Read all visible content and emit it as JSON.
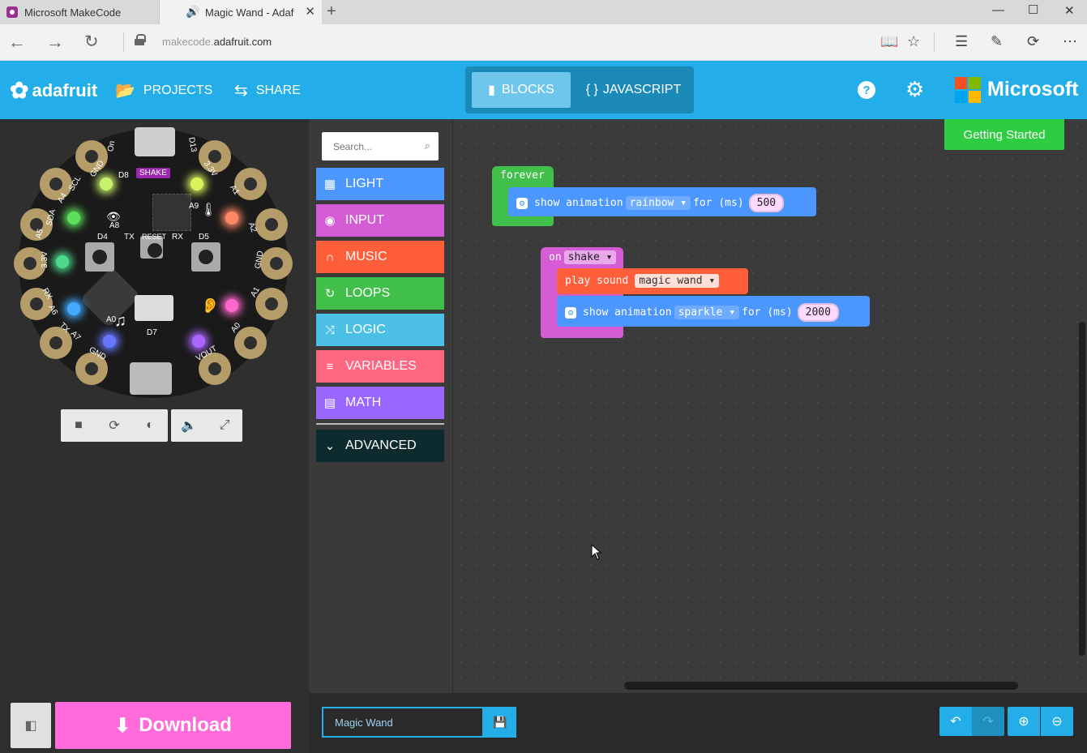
{
  "browser": {
    "tabs": [
      {
        "title": "Microsoft MakeCode"
      },
      {
        "title": "Magic Wand - Adaf"
      }
    ],
    "address": {
      "prefix": "makecode.",
      "domain": "adafruit.com"
    }
  },
  "header": {
    "brand": "adafruit",
    "projects_label": "PROJECTS",
    "share_label": "SHARE",
    "blocks_label": "BLOCKS",
    "javascript_label": "JAVASCRIPT",
    "microsoft_label": "Microsoft"
  },
  "simulator": {
    "shake_label": "SHAKE",
    "pin_labels": [
      "On",
      "D13",
      "GND",
      "3.3V",
      "D8",
      "A1",
      "A9",
      "SCL",
      "A4",
      "A2",
      "SDA",
      "A5",
      "A8",
      "D4",
      "TX",
      "RESET",
      "RX",
      "D5",
      "3.3V",
      "GND",
      "RX",
      "A6",
      "A1",
      "TX",
      "A7",
      "A0",
      "D7",
      "GND",
      "VOUT",
      "A0"
    ],
    "led_colors": [
      "#c8f26b",
      "#d9f35a",
      "#5be05b",
      "#ff8866",
      "#4cd98a",
      "#ffffff",
      "#44aaff",
      "#ff66cc",
      "#6677ff",
      "#aa66ff"
    ]
  },
  "toolbox": {
    "search_placeholder": "Search...",
    "categories": [
      {
        "label": "LIGHT",
        "color": "#4c97ff",
        "icon": "grid-icon"
      },
      {
        "label": "INPUT",
        "color": "#d65cd6",
        "icon": "target-icon"
      },
      {
        "label": "MUSIC",
        "color": "#ff5e3a",
        "icon": "headphones-icon"
      },
      {
        "label": "LOOPS",
        "color": "#40bf4a",
        "icon": "refresh-icon"
      },
      {
        "label": "LOGIC",
        "color": "#4cbfe6",
        "icon": "shuffle-icon"
      },
      {
        "label": "VARIABLES",
        "color": "#ff6680",
        "icon": "lines-icon"
      },
      {
        "label": "MATH",
        "color": "#9966ff",
        "icon": "calculator-icon"
      }
    ],
    "advanced_label": "ADVANCED"
  },
  "workspace": {
    "getting_started": "Getting Started",
    "forever_block": {
      "hat": "forever",
      "show_label": "show animation",
      "animation": "rainbow",
      "for_label": "for (ms)",
      "ms": "500"
    },
    "shake_block": {
      "on_label": "on",
      "gesture": "shake",
      "play_label": "play sound",
      "sound": "magic wand",
      "show_label": "show animation",
      "animation": "sparkle",
      "for_label": "for (ms)",
      "ms": "2000"
    },
    "colors": {
      "loops": "#40bf4a",
      "input": "#d65cd6",
      "music": "#ff5e3a",
      "light": "#4c97ff"
    }
  },
  "bottom": {
    "download_label": "Download",
    "project_name": "Magic Wand"
  }
}
